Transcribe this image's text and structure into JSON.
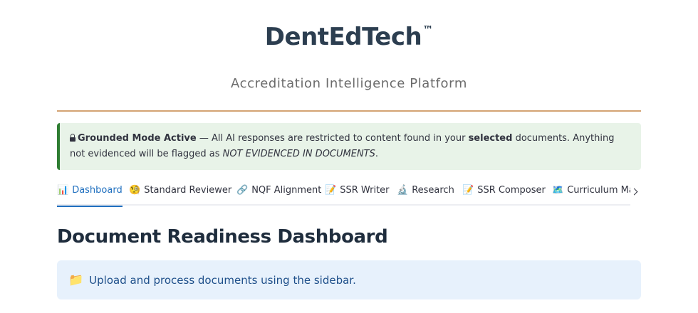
{
  "header": {
    "brand_name": "DentEdTech",
    "trademark": "™",
    "tagline": "Accreditation Intelligence Platform"
  },
  "notice": {
    "icon": "lock-icon",
    "title": "Grounded Mode Active",
    "text_1": " — All AI responses are restricted to content found in your ",
    "emphasis": "selected",
    "text_2": " documents. Anything not evidenced will be flagged as ",
    "flag_text": "NOT EVIDENCED IN DOCUMENTS",
    "text_3": ".",
    "colors": {
      "background": "#e8f3e8",
      "border": "#2e7d32"
    }
  },
  "tabs": [
    {
      "emoji": "📊",
      "label": "Dashboard",
      "active": true
    },
    {
      "emoji": "🧐",
      "label": "Standard Reviewer",
      "active": false
    },
    {
      "emoji": "🔗",
      "label": "NQF Alignment",
      "active": false
    },
    {
      "emoji": "📝",
      "label": "SSR Writer",
      "active": false
    },
    {
      "emoji": "🔬",
      "label": "Research",
      "active": false
    },
    {
      "emoji": "📝",
      "label": "SSR Composer",
      "active": false
    },
    {
      "emoji": "🗺️",
      "label": "Curriculum Map",
      "active": false
    }
  ],
  "tabs_scroll_icon": "chevron-right-icon",
  "main": {
    "title": "Document Readiness Dashboard",
    "info_icon": "📁",
    "info_text": "Upload and process documents using the sidebar."
  },
  "colors": {
    "accent": "#1f6fbf",
    "divider": "#d4a373",
    "brand": "#2c3e50",
    "info_background": "#e7f1fc"
  }
}
